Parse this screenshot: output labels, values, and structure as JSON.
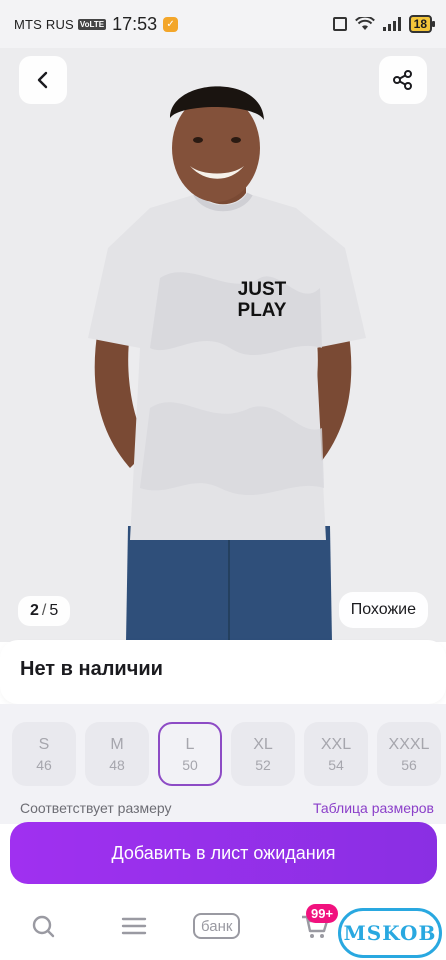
{
  "status_bar": {
    "carrier": "MTS RUS",
    "volte": "VoLTE",
    "time": "17:53",
    "battery": "18"
  },
  "product": {
    "shirt_print_line1": "JUST",
    "shirt_print_line2": "PLAY",
    "image_counter_current": "2",
    "image_counter_total": "5",
    "similar_label": "Похожие"
  },
  "availability": "Нет в наличии",
  "sizes": [
    {
      "label": "S",
      "number": "46",
      "selected": false
    },
    {
      "label": "M",
      "number": "48",
      "selected": false
    },
    {
      "label": "L",
      "number": "50",
      "selected": true
    },
    {
      "label": "XL",
      "number": "52",
      "selected": false
    },
    {
      "label": "XXL",
      "number": "54",
      "selected": false
    },
    {
      "label": "XXXL",
      "number": "56",
      "selected": false
    }
  ],
  "size_note": "Соответствует размеру",
  "size_table_link": "Таблица размеров",
  "cta_label": "Добавить в лист ожидания",
  "bottom_nav": {
    "bank_label": "банк",
    "cart_badge": "99+"
  },
  "watermark": "MSKOB",
  "colors": {
    "accent": "#8b3fc9",
    "cta": "#9a30ee",
    "badge": "#f1117e"
  }
}
